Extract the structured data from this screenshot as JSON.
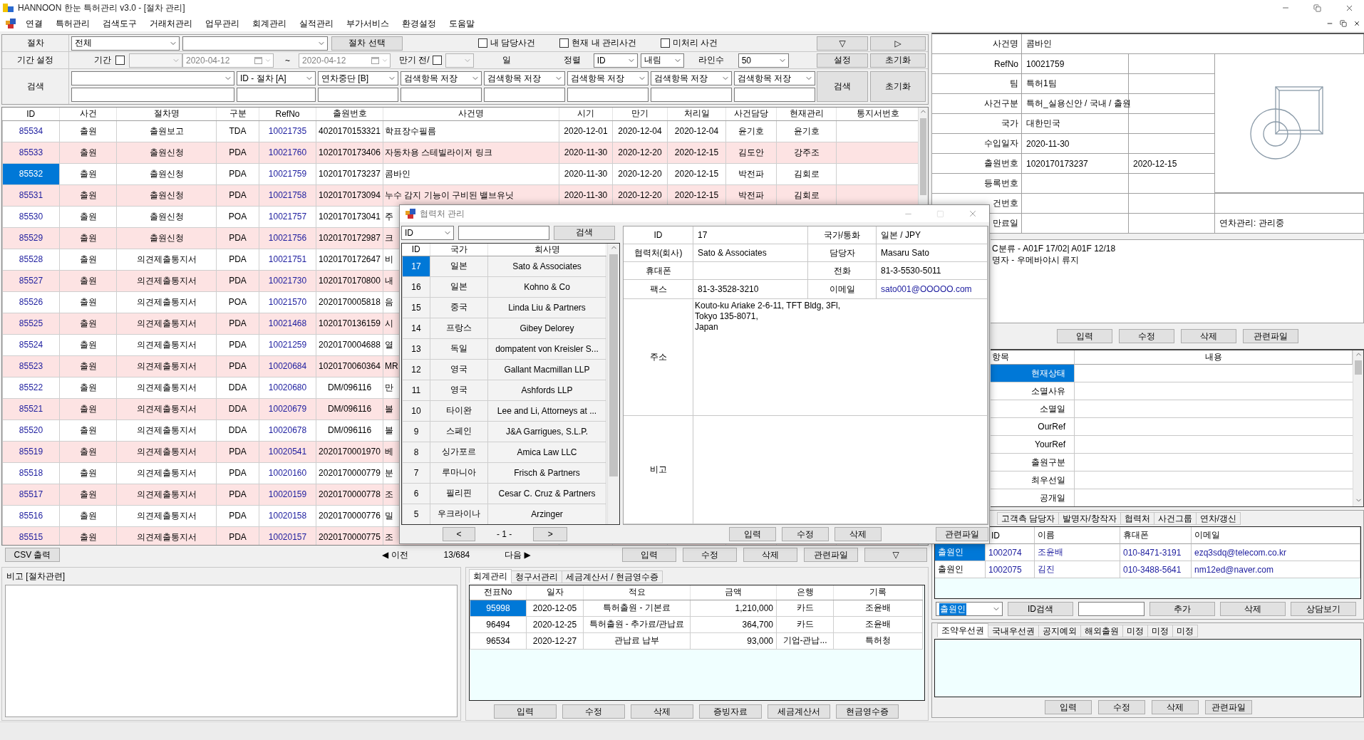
{
  "window": {
    "title": "HANNOON 한눈 특허관리 v3.0 - [절차 관리]"
  },
  "menu": [
    "연결",
    "특허관리",
    "검색도구",
    "거래처관리",
    "업무관리",
    "회계관리",
    "실적관리",
    "부가서비스",
    "환경설정",
    "도움말"
  ],
  "filter": {
    "procedure": {
      "label": "절차",
      "value": "전체",
      "button": "절차 선택",
      "checks": [
        {
          "label": "내 담당사건",
          "checked": false
        },
        {
          "label": "현재 내 관리사건",
          "checked": false
        },
        {
          "label": "미처리 사건",
          "checked": false
        }
      ],
      "buttons": [
        "▽",
        "▷"
      ]
    },
    "period": {
      "label": "기간 설정",
      "period": {
        "label": "기간",
        "checked": false
      },
      "from": "2020-04-12",
      "separator": "~",
      "to": "2020-04-12",
      "due": {
        "label": "만기 전/",
        "checked": false
      },
      "day_unit": "일",
      "sort_label": "정렬",
      "sort_field": "ID",
      "sort_order": "내림",
      "lines_label": "라인수",
      "lines": "50",
      "buttons": [
        "설정",
        "초기화"
      ]
    },
    "search": {
      "label": "검색",
      "columns": [
        "ID - 절차 [A]",
        "연차중단 [B]",
        "검색항목 저장",
        "검색항목 저장",
        "검색항목 저장",
        "검색항목 저장",
        "검색항목 저장"
      ],
      "buttons": [
        "검색",
        "초기화"
      ]
    }
  },
  "table": {
    "columns": [
      "ID",
      "사건",
      "절차명",
      "구분",
      "RefNo",
      "출원번호",
      "사건명",
      "시기",
      "만기",
      "처리일",
      "사건담당",
      "현재관리",
      "통지서번호"
    ],
    "rows": [
      {
        "selected": false,
        "cells": [
          "85534",
          "출원",
          "출원보고",
          "TDA",
          "10021735",
          "4020170153321",
          "학표장수필름",
          "2020-12-01",
          "2020-12-04",
          "2020-12-04",
          "윤기호",
          "윤기호"
        ]
      },
      {
        "selected": false,
        "cells": [
          "85533",
          "출원",
          "출원신청",
          "PDA",
          "10021760",
          "1020170173406",
          "자동차용 스테빌라이저 링크",
          "2020-11-30",
          "2020-12-20",
          "2020-12-15",
          "김도안",
          "강주조"
        ]
      },
      {
        "selected": true,
        "cells": [
          "85532",
          "출원",
          "출원신청",
          "PDA",
          "10021759",
          "1020170173237",
          "콤바인",
          "2020-11-30",
          "2020-12-20",
          "2020-12-15",
          "박전파",
          "김회로"
        ]
      },
      {
        "selected": false,
        "cells": [
          "85531",
          "출원",
          "출원신청",
          "PDA",
          "10021758",
          "1020170173094",
          "누수 감지 기능이 구비된 밸브유닛",
          "2020-11-30",
          "2020-12-20",
          "2020-12-15",
          "박전파",
          "김회로"
        ]
      },
      {
        "selected": false,
        "cells": [
          "85530",
          "출원",
          "출원신청",
          "POA",
          "10021757",
          "1020170173041",
          "주"
        ]
      },
      {
        "selected": false,
        "cells": [
          "85529",
          "출원",
          "출원신청",
          "PDA",
          "10021756",
          "1020170172987",
          "크"
        ]
      },
      {
        "selected": false,
        "cells": [
          "85528",
          "출원",
          "의견제출통지서",
          "PDA",
          "10021751",
          "1020170172647",
          "비"
        ]
      },
      {
        "selected": false,
        "cells": [
          "85527",
          "출원",
          "의견제출통지서",
          "PDA",
          "10021730",
          "1020170170800",
          "내"
        ]
      },
      {
        "selected": false,
        "cells": [
          "85526",
          "출원",
          "의견제출통지서",
          "POA",
          "10021570",
          "2020170005818",
          "음"
        ]
      },
      {
        "selected": false,
        "cells": [
          "85525",
          "출원",
          "의견제출통지서",
          "PDA",
          "10021468",
          "1020170136159",
          "시"
        ]
      },
      {
        "selected": false,
        "cells": [
          "85524",
          "출원",
          "의견제출통지서",
          "PDA",
          "10021259",
          "2020170004688",
          "열"
        ]
      },
      {
        "selected": false,
        "cells": [
          "85523",
          "출원",
          "의견제출통지서",
          "PDA",
          "10020684",
          "1020170060364",
          "MR"
        ]
      },
      {
        "selected": false,
        "cells": [
          "85522",
          "출원",
          "의견제출통지서",
          "DDA",
          "10020680",
          "DM/096116",
          "만"
        ]
      },
      {
        "selected": false,
        "cells": [
          "85521",
          "출원",
          "의견제출통지서",
          "DDA",
          "10020679",
          "DM/096116",
          "볼"
        ]
      },
      {
        "selected": false,
        "cells": [
          "85520",
          "출원",
          "의견제출통지서",
          "DDA",
          "10020678",
          "DM/096116",
          "볼"
        ]
      },
      {
        "selected": false,
        "cells": [
          "85519",
          "출원",
          "의견제출통지서",
          "PDA",
          "10020541",
          "2020170001970",
          "베"
        ]
      },
      {
        "selected": false,
        "cells": [
          "85518",
          "출원",
          "의견제출통지서",
          "PDA",
          "10020160",
          "2020170000779",
          "분"
        ]
      },
      {
        "selected": false,
        "cells": [
          "85517",
          "출원",
          "의견제출통지서",
          "PDA",
          "10020159",
          "2020170000778",
          "조"
        ]
      },
      {
        "selected": false,
        "cells": [
          "85516",
          "출원",
          "의견제출통지서",
          "PDA",
          "10020158",
          "2020170000776",
          "밀"
        ]
      },
      {
        "selected": false,
        "cells": [
          "85515",
          "출원",
          "의견제출통지서",
          "PDA",
          "10020157",
          "2020170000775",
          "조"
        ]
      }
    ]
  },
  "pager": {
    "export": "CSV 출력",
    "prev": "◀ 이전",
    "count": "13/684",
    "next": "다음 ▶",
    "buttons": [
      "입력",
      "수정",
      "삭제",
      "관련파일",
      "▽"
    ]
  },
  "procedure_note": {
    "label": "비고 [절차관련]"
  },
  "accounting": {
    "tabs": [
      {
        "label": "회계관리",
        "selected": true
      },
      {
        "label": "청구서관리",
        "selected": false
      },
      {
        "label": "세금계산서 / 현금영수증",
        "selected": false
      }
    ],
    "columns": [
      "전표No",
      "일자",
      "적요",
      "금액",
      "은행",
      "기록"
    ],
    "rows": [
      {
        "selected": true,
        "cells": [
          "95998",
          "2020-12-05",
          "특허출원 - 기본료",
          "1,210,000",
          "카드",
          "조윤배"
        ]
      },
      {
        "selected": false,
        "cells": [
          "96494",
          "2020-12-25",
          "특허출원 - 추가료/관납료",
          "364,700",
          "카드",
          "조윤배"
        ]
      },
      {
        "selected": false,
        "cells": [
          "96534",
          "2020-12-27",
          "관납료 납부",
          "93,000",
          "기업-관납...",
          "특허청"
        ]
      }
    ],
    "buttons": [
      "입력",
      "수정",
      "삭제",
      "증빙자료",
      "세금계산서",
      "현금영수증"
    ]
  },
  "case_info": {
    "rows": [
      {
        "kind": "wide",
        "label": "사건명",
        "value": "콤바인"
      },
      {
        "kind": "plain",
        "label": "RefNo",
        "value": "10021759"
      },
      {
        "kind": "plain",
        "label": "팀",
        "value": "특허1팀"
      },
      {
        "kind": "plain",
        "label": "사건구분",
        "value": "특허_실용신안 / 국내 / 출원"
      },
      {
        "kind": "plain",
        "label": "국가",
        "value": "대한민국"
      },
      {
        "kind": "plain",
        "label": "수입일자",
        "value": "2020-11-30"
      },
      {
        "kind": "plain",
        "label": "출원번호",
        "value": "1020170173237",
        "extra": "2020-12-15"
      },
      {
        "kind": "plain",
        "label": "등록번호"
      },
      {
        "kind": "side",
        "label": "건번호"
      },
      {
        "kind": "side",
        "label": "만료일",
        "note": "연차관리: 관리중"
      }
    ]
  },
  "memo": {
    "lines": [
      "C분류 - A01F 17/02| A01F 12/18",
      "명자 - 우메바야시 류지"
    ],
    "buttons": [
      "입력",
      "수정",
      "삭제",
      "관련파일"
    ]
  },
  "properties": {
    "columns": [
      "항목",
      "내용"
    ],
    "rows": [
      {
        "label": "현재상태",
        "selected": true
      },
      {
        "label": "소멸사유",
        "selected": false
      },
      {
        "label": "소멸일",
        "selected": false
      },
      {
        "label": "OurRef",
        "selected": false
      },
      {
        "label": "YourRef",
        "selected": false
      },
      {
        "label": "출원구분",
        "selected": false
      },
      {
        "label": "최우선일",
        "selected": false
      },
      {
        "label": "공개일",
        "selected": false
      }
    ]
  },
  "contacts": {
    "tabs": [
      {
        "label": "고객측 담당자",
        "selected": false
      },
      {
        "label": "발명자/창작자",
        "selected": false
      },
      {
        "label": "협력처",
        "selected": false
      },
      {
        "label": "사건그룹",
        "selected": false
      },
      {
        "label": "연차/갱신",
        "selected": false
      }
    ],
    "columns": [
      "ID",
      "이름",
      "휴대폰",
      "이메일"
    ],
    "rows": [
      {
        "selected": true,
        "role": "출원인",
        "cells": [
          "1002074",
          "조윤배",
          "010-8471-3191",
          "ezq3sdq@telecom.co.kr"
        ]
      },
      {
        "selected": false,
        "role": "출원인",
        "cells": [
          "1002075",
          "김진",
          "010-3488-5641",
          "nm12ed@naver.com"
        ]
      }
    ],
    "controls": {
      "role": "출원인",
      "search_button": "ID검색",
      "buttons": [
        "추가",
        "삭제",
        "상담보기"
      ]
    }
  },
  "priority": {
    "tabs": [
      {
        "label": "조약우선권",
        "selected": true
      },
      {
        "label": "국내우선권",
        "selected": false
      },
      {
        "label": "공지예외",
        "selected": false
      },
      {
        "label": "해외출원",
        "selected": false
      },
      {
        "label": "미정",
        "selected": false
      },
      {
        "label": "미정",
        "selected": false
      },
      {
        "label": "미정",
        "selected": false
      }
    ],
    "buttons": [
      "입력",
      "수정",
      "삭제",
      "관련파일"
    ]
  },
  "dialog": {
    "title": "협력처 관리",
    "search": {
      "field": "ID",
      "button": "검색"
    },
    "list": {
      "columns": [
        "ID",
        "국가",
        "회사명"
      ],
      "rows": [
        {
          "selected": true,
          "cells": [
            "17",
            "일본",
            "Sato & Associates"
          ]
        },
        {
          "selected": false,
          "cells": [
            "16",
            "일본",
            "Kohno & Co"
          ]
        },
        {
          "selected": false,
          "cells": [
            "15",
            "중국",
            "Linda Liu & Partners"
          ]
        },
        {
          "selected": false,
          "cells": [
            "14",
            "프랑스",
            "Gibey Delorey"
          ]
        },
        {
          "selected": false,
          "cells": [
            "13",
            "독일",
            "dompatent von Kreisler S..."
          ]
        },
        {
          "selected": false,
          "cells": [
            "12",
            "영국",
            "Gallant Macmillan LLP"
          ]
        },
        {
          "selected": false,
          "cells": [
            "11",
            "영국",
            "Ashfords LLP"
          ]
        },
        {
          "selected": false,
          "cells": [
            "10",
            "타이완",
            "Lee and Li, Attorneys at ..."
          ]
        },
        {
          "selected": false,
          "cells": [
            "9",
            "스페인",
            "J&A Garrigues, S.L.P."
          ]
        },
        {
          "selected": false,
          "cells": [
            "8",
            "싱가포르",
            "Amica Law LLC"
          ]
        },
        {
          "selected": false,
          "cells": [
            "7",
            "루마니아",
            "Frisch & Partners"
          ]
        },
        {
          "selected": false,
          "cells": [
            "6",
            "필리핀",
            "Cesar C. Cruz & Partners"
          ]
        },
        {
          "selected": false,
          "cells": [
            "5",
            "우크라이나",
            "Arzinger"
          ]
        }
      ]
    },
    "pager": {
      "prev": "<",
      "page": "- 1 -",
      "next": ">"
    },
    "detail": {
      "rows": [
        {
          "kind": "text",
          "label": "ID",
          "value": "17",
          "label2": "국가/통화",
          "value2": "일본 / JPY"
        },
        {
          "kind": "text",
          "label": "협력처(회사)",
          "value": "Sato & Associates",
          "label2": "담당자",
          "value2": "Masaru Sato"
        },
        {
          "kind": "text",
          "label": "휴대폰",
          "label2": "전화",
          "value2": "81-3-5530-5011"
        },
        {
          "kind": "email",
          "label": "팩스",
          "value": "81-3-3528-3210",
          "label2": "이메일",
          "value2": "sato001@OOOOO.com"
        }
      ],
      "address": {
        "label": "주소",
        "lines": [
          "Kouto-ku Ariake 2-6-11, TFT Bldg, 3Fl,",
          "Tokyo 135-8071,",
          "Japan"
        ]
      },
      "note": {
        "label": "비고"
      }
    },
    "buttons": [
      "입력",
      "수정",
      "삭제",
      "관련파일"
    ]
  }
}
